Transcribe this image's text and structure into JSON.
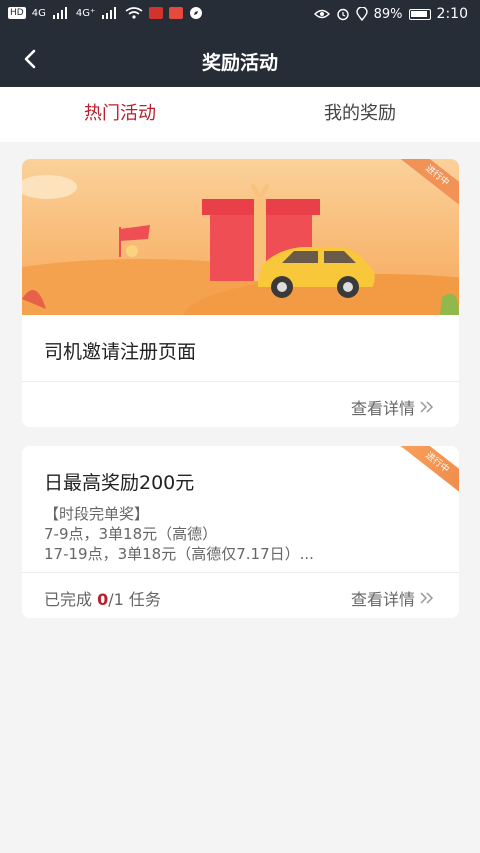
{
  "status_bar": {
    "left_badges": [
      "HD",
      "4G",
      "4G⁺"
    ],
    "battery": "89%",
    "time": "2:10"
  },
  "header": {
    "title": "奖励活动"
  },
  "tabs": [
    {
      "label": "热门活动",
      "active": true
    },
    {
      "label": "我的奖励",
      "active": false
    }
  ],
  "cards": [
    {
      "ribbon": "进行中",
      "title": "司机邀请注册页面",
      "more_label": "查看详情"
    },
    {
      "ribbon": "进行中",
      "title": "日最高奖励200元",
      "desc_lines": [
        "【时段完单奖】",
        "7-9点，3单18元（高德）",
        "17-19点，3单18元（高德仅7.17日）..."
      ],
      "progress_prefix": "已完成 ",
      "progress_done": "0",
      "progress_suffix": "/1 任务",
      "more_label": "查看详情"
    }
  ],
  "colors": {
    "header_bg": "#262d37",
    "accent": "#b8202d",
    "page_bg": "#f4f4f4"
  }
}
